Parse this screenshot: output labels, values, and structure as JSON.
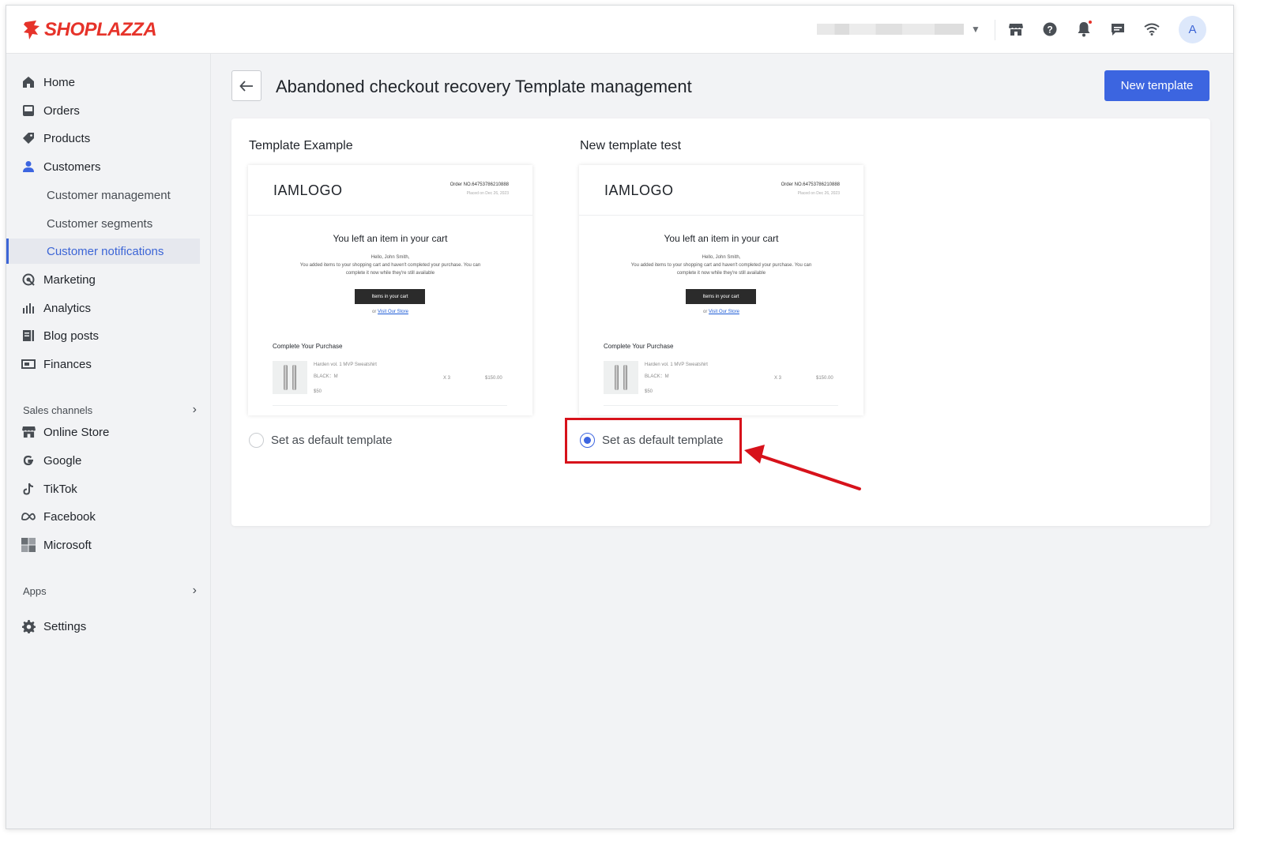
{
  "brand": {
    "name": "SHOPLAZZA",
    "accent": "#e6332a",
    "primary": "#3c65e0"
  },
  "topbar": {
    "icons": [
      "store-icon",
      "help-icon",
      "bell-icon",
      "message-icon",
      "wifi-icon"
    ],
    "avatar_initial": "A"
  },
  "sidebar": {
    "items": [
      {
        "label": "Home",
        "icon": "home-icon"
      },
      {
        "label": "Orders",
        "icon": "orders-icon"
      },
      {
        "label": "Products",
        "icon": "tag-icon"
      },
      {
        "label": "Customers",
        "icon": "person-icon"
      }
    ],
    "customer_subitems": [
      {
        "label": "Customer management"
      },
      {
        "label": "Customer segments"
      },
      {
        "label": "Customer notifications",
        "active": true
      }
    ],
    "items2": [
      {
        "label": "Marketing",
        "icon": "marketing-icon"
      },
      {
        "label": "Analytics",
        "icon": "analytics-icon"
      },
      {
        "label": "Blog posts",
        "icon": "blog-icon"
      },
      {
        "label": "Finances",
        "icon": "finances-icon"
      }
    ],
    "sales_channels_label": "Sales channels",
    "channels": [
      {
        "label": "Online Store",
        "icon": "store-icon"
      },
      {
        "label": "Google",
        "icon": "google-icon"
      },
      {
        "label": "TikTok",
        "icon": "tiktok-icon"
      },
      {
        "label": "Facebook",
        "icon": "meta-icon"
      },
      {
        "label": "Microsoft",
        "icon": "microsoft-icon"
      }
    ],
    "apps_label": "Apps",
    "settings_label": "Settings"
  },
  "page": {
    "title": "Abandoned checkout recovery Template management",
    "new_template_label": "New template"
  },
  "templates": [
    {
      "name": "Template Example",
      "default": false,
      "radio_label": "Set as default template",
      "preview": {
        "logo": "IAMLOGO",
        "order_no": "Order NO.64753786210888",
        "placed": "Placed on Dec 26, 2023",
        "heading": "You left an item in your cart",
        "greeting": "Hello, John Smith,",
        "body": "You added items to your shopping cart and haven't completed your purchase. You can complete it now while they're still available",
        "button": "Items in your cart",
        "or_text": "or",
        "visit_link": "Visit Our Store",
        "complete": "Complete Your Purchase",
        "product_name": "Harden vol. 1 MVP Sweatshirt",
        "variant": "BLACK：M",
        "unit_price": "$50",
        "qty": "X 3",
        "total": "$150.00"
      }
    },
    {
      "name": "New template test",
      "default": true,
      "radio_label": "Set as default template",
      "preview": {
        "logo": "IAMLOGO",
        "order_no": "Order NO.64753786210888",
        "placed": "Placed on Dec 26, 2023",
        "heading": "You left an item in your cart",
        "greeting": "Hello, John Smith,",
        "body": "You added items to your shopping cart and haven't completed your purchase. You can complete it now while they're still available",
        "button": "Items in your cart",
        "or_text": "or",
        "visit_link": "Visit Our Store",
        "complete": "Complete Your Purchase",
        "product_name": "Harden vol. 1 MVP Sweatshirt",
        "variant": "BLACK：M",
        "unit_price": "$50",
        "qty": "X 3",
        "total": "$150.00"
      }
    }
  ],
  "annotation": {
    "color": "#d7121b"
  }
}
